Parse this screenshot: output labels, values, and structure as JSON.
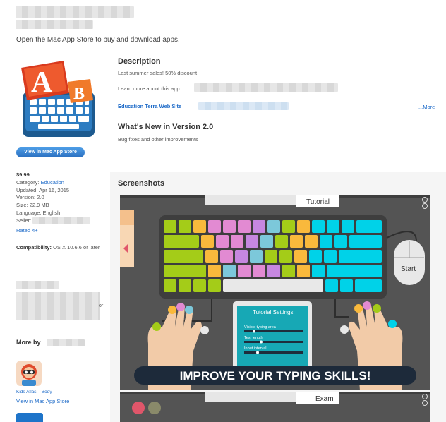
{
  "header": {
    "open_message": "Open the Mac App Store to buy and download apps."
  },
  "app": {
    "view_button": "View in Mac App Store",
    "price": "$9.99",
    "category_label": "Category:",
    "category_value": "Education",
    "updated": "Updated: Apr 16, 2015",
    "version": "Version: 2.0",
    "size": "Size: 22.9 MB",
    "language": "Language: English",
    "seller_label": "Seller:",
    "rating": "Rated 4+",
    "compatibility_label": "Compatibility:",
    "compatibility_value": "OS X 10.6.6 or later",
    "icon_letters": [
      "A",
      "B"
    ]
  },
  "sidebar": {
    "or_text": "or",
    "more_by": "More by",
    "more_app_label": "Kids Atlas – Body",
    "view_link": "View in Mac App Store"
  },
  "description": {
    "heading": "Description",
    "line1": "Last summer sales! 50% discount",
    "line2": "Learn more about this app:",
    "website_link": "Education Terra Web Site",
    "more_link": "...More"
  },
  "whats_new": {
    "heading": "What's New in Version 2.0",
    "text": "Bug fixes and other improvements"
  },
  "screenshots": {
    "heading": "Screenshots",
    "shot1_tab": "Tutorial",
    "shot1_mouse": "Start",
    "shot1_settings_title": "Tutorial Settings",
    "shot1_settings_rows": [
      "Visible typing area",
      "Text length",
      "Input interval"
    ],
    "shot1_banner": "IMPROVE YOUR TYPING SKILLS!",
    "shot2_tab": "Exam"
  },
  "colors": {
    "link": "#1e6bc8",
    "screenshot_bg": "#545454",
    "banner_bg": "#1d2a3a",
    "settings_bg": "#17a8b5"
  }
}
